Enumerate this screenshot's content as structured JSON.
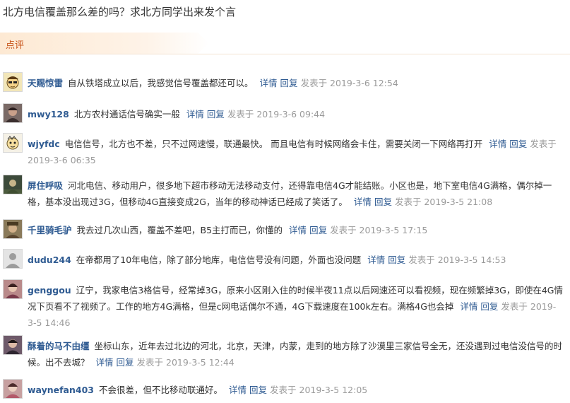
{
  "title": "北方电信覆盖那么差的吗？求北方同学出来发个言",
  "section_label": "点评",
  "labels": {
    "detail": "详情",
    "reply": "回复"
  },
  "comments": [
    {
      "user": "天赐惊雷",
      "text": "自从铁塔成立以后，我感觉信号覆盖都还可以。",
      "time": "发表于 2019-3-6 12:54",
      "avatar_icon": "cartoon-face-avatar"
    },
    {
      "user": "mwy128",
      "text": "北方农村通话信号确实一般",
      "time": "发表于 2019-3-6 09:44",
      "avatar_icon": "person-photo-avatar"
    },
    {
      "user": "wjyfdc",
      "text": "电信信号，北方也不差，只不过网速慢，联通最快。 而且电信有时候网络会卡住，需要关闭一下网络再打开",
      "time": "发表于 2019-3-6 06:35",
      "avatar_icon": "cartoon-face-avatar"
    },
    {
      "user": "屏住呼吸",
      "text": "河北电信、移动用户，很多地下超市移动无法移动支付，还得靠电信4G才能结账。小区也是，地下室电信4G满格，偶尔掉一格，基本没出现过3G，但移动4G直接变成2G，当年的移动神话已经成了笑话了。",
      "time": "发表于 2019-3-5 21:08",
      "avatar_icon": "dark-figure-avatar"
    },
    {
      "user": "千里骑毛驴",
      "text": "我去过几次山西，覆盖不差吧，B5主打而已，你懂的",
      "time": "发表于 2019-3-5 17:15",
      "avatar_icon": "person-photo-avatar"
    },
    {
      "user": "dudu244",
      "text": "在帝都用了10年电信，除了部分地库，电信信号没有问题，外面也没问题",
      "time": "发表于 2019-3-5 14:53",
      "avatar_icon": "default-silhouette-avatar"
    },
    {
      "user": "genggou",
      "text": "辽宁，我家电信3格信号，经常掉3G，原来小区刚入住的时候半夜11点以后网速还可以看视频，现在频繁掉3G，即使在4G情况下页看不了视频了。工作的地方4G满格，但是c网电话偶尔不通，4G下载速度在100k左右。满格4G也会掉",
      "time": "发表于 2019-3-5 14:46",
      "avatar_icon": "person-photo-avatar"
    },
    {
      "user": "酥着的马不由缰",
      "text": "坐标山东，近年去过北边的河北，北京，天津，内蒙，走到的地方除了沙漠里三家信号全无，还没遇到过电信没信号的时候。出不去城？",
      "time": "发表于 2019-3-5 12:44",
      "avatar_icon": "person-photo-avatar"
    },
    {
      "user": "waynefan403",
      "text": "不会很差，但不比移动联通好。",
      "time": "发表于 2019-3-5 12:05",
      "avatar_icon": "person-photo-avatar"
    }
  ]
}
